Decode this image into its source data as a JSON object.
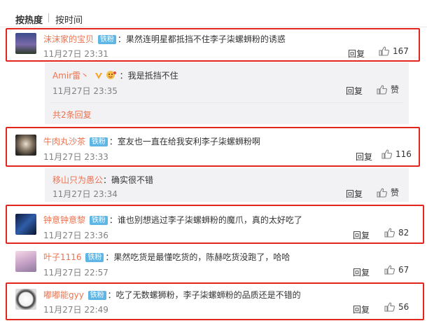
{
  "sort": {
    "hot": "按热度",
    "time": "按时间"
  },
  "comments": [
    {
      "name": "沫沫家的宝贝",
      "badge": "铁粉",
      "text": "果然连明星都抵挡不住李子柒螺蛳粉的诱惑",
      "time": "11月27日 23:31",
      "reply": "回复",
      "likes": "167"
    },
    {
      "name": "Amir雷丶",
      "text": "我是抵挡不住",
      "time": "11月27日 23:35",
      "reply": "回复",
      "likes": "赞"
    },
    {
      "more": "共2条回复"
    },
    {
      "name": "牛肉丸沙茶",
      "badge": "铁粉",
      "text": "室友也一直在给我安利李子柒螺蛳粉啊",
      "time": "11月27日 23:33",
      "reply": "回复",
      "likes": "116"
    },
    {
      "name": "移山只为愚公",
      "text": "确实很不错",
      "time": "11月27日 23:34",
      "reply": "回复",
      "likes": "赞"
    },
    {
      "name": "钟意钟意黎",
      "badge": "铁粉",
      "text": "谁也别想逃过李子柒螺蛳粉的魔爪，真的太好吃了",
      "time": "11月27日 23:36",
      "reply": "回复",
      "likes": "82"
    },
    {
      "name": "叶子1116",
      "badge": "铁粉",
      "text": "果然吃货是最懂吃货的，陈赫吃货没跑了，哈哈",
      "time": "11月27日 22:57",
      "reply": "回复",
      "likes": "67"
    },
    {
      "name": "嘟嘟能gyy",
      "badge": "铁粉",
      "text": "吃了无数螺狮粉，李子柒螺蛳粉的品质还是不错的",
      "time": "11月27日 22:49",
      "reply": "回复",
      "likes": "56"
    }
  ],
  "colors": {
    "username": "#eb7350",
    "badge": "#5fb6e5",
    "highlight": "#e2261e",
    "sub_bg": "#f2f2f5"
  },
  "icons": {
    "like": "thumbs-up-icon",
    "emoji": "emoji-icon",
    "vip": "vip-v-icon"
  }
}
